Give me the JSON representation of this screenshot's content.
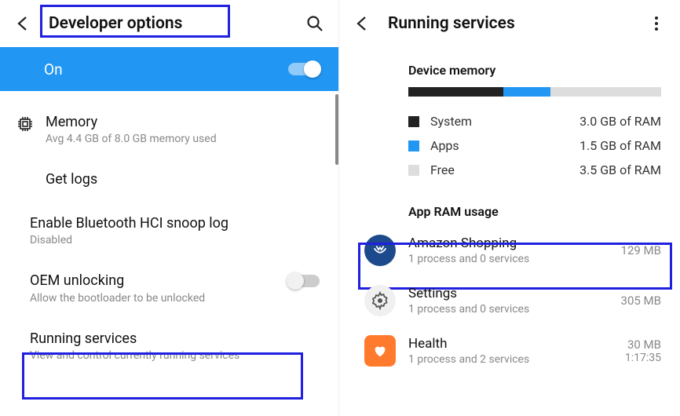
{
  "left": {
    "title": "Developer options",
    "on_label": "On",
    "items": {
      "memory": {
        "title": "Memory",
        "sub": "Avg 4.4 GB of 8.0 GB memory used"
      },
      "get_logs": {
        "title": "Get logs"
      },
      "hci_snoop": {
        "title": "Enable Bluetooth HCI snoop log",
        "sub": "Disabled"
      },
      "oem_unlock": {
        "title": "OEM unlocking",
        "sub": "Allow the bootloader to be unlocked"
      },
      "running_services": {
        "title": "Running services",
        "sub": "View and control currently running services"
      }
    }
  },
  "right": {
    "title": "Running services",
    "device_memory_label": "Device memory",
    "mem": {
      "system": {
        "label": "System",
        "value": "3.0 GB of RAM",
        "color": "#222",
        "pct": 37.5
      },
      "apps": {
        "label": "Apps",
        "value": "1.5 GB of RAM",
        "color": "#2196f3",
        "pct": 18.75
      },
      "free": {
        "label": "Free",
        "value": "3.5 GB of RAM",
        "color": "#ddd",
        "pct": 43.75
      }
    },
    "app_ram_label": "App RAM usage",
    "apps": [
      {
        "name": "Amazon Shopping",
        "sub": "1 process and 0 services",
        "meta": "129 MB",
        "icon_bg": "#1d4a8c",
        "icon_glyph": "amazon"
      },
      {
        "name": "Settings",
        "sub": "1 process and 0 services",
        "meta": "305 MB",
        "icon_bg": "#eee",
        "icon_glyph": "gear"
      },
      {
        "name": "Health",
        "sub": "1 process and 2 services",
        "meta": "30 MB",
        "meta2": "1:17:35",
        "icon_bg": "#ff7a2d",
        "icon_glyph": "heart"
      }
    ]
  }
}
